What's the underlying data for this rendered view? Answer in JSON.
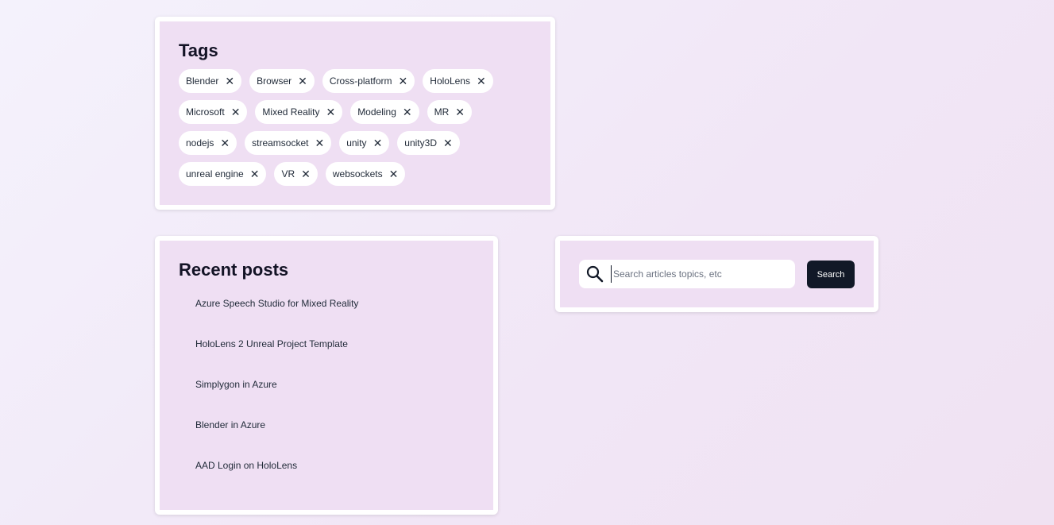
{
  "tags": {
    "title": "Tags",
    "items": [
      "Blender",
      "Browser",
      "Cross-platform",
      "HoloLens",
      "Microsoft",
      "Mixed Reality",
      "Modeling",
      "MR",
      "nodejs",
      "streamsocket",
      "unity",
      "unity3D",
      "unreal engine",
      "VR",
      "websockets"
    ],
    "remove_glyph": "✕"
  },
  "recent_posts": {
    "title": "Recent posts",
    "items": [
      "Azure Speech Studio for Mixed Reality",
      "HoloLens 2 Unreal Project Template",
      "Simplygon in Azure",
      "Blender in Azure",
      "AAD Login on HoloLens"
    ]
  },
  "search": {
    "placeholder": "Search articles topics, etc",
    "value": "",
    "button_label": "Search",
    "icon": "search-icon"
  },
  "colors": {
    "card_background": "#efdff3",
    "card_border": "#ffffff",
    "button_background": "#111827",
    "text": "#131325"
  }
}
